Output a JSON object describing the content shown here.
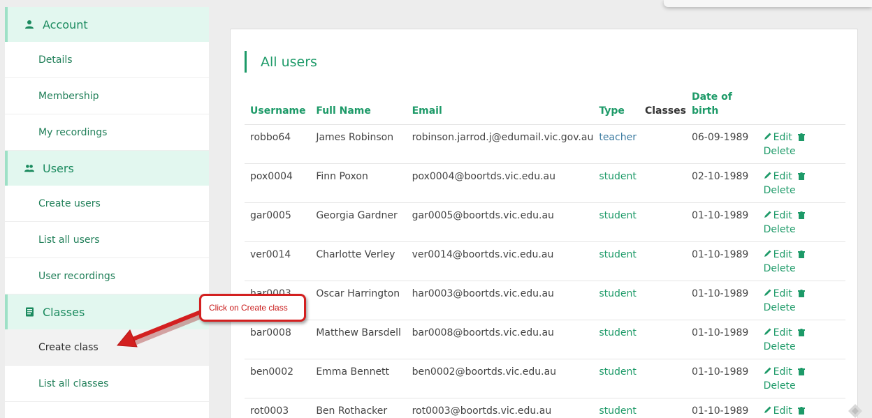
{
  "sidebar": {
    "sections": [
      {
        "title": "Account",
        "icon": "user-icon",
        "items": [
          "Details",
          "Membership",
          "My recordings"
        ]
      },
      {
        "title": "Users",
        "icon": "users-icon",
        "items": [
          "Create users",
          "List all users",
          "User recordings"
        ]
      },
      {
        "title": "Classes",
        "icon": "book-icon",
        "items": [
          "Create class",
          "List all classes"
        ]
      }
    ],
    "active_item": "Create class"
  },
  "main": {
    "title": "All users",
    "columns": [
      "Username",
      "Full Name",
      "Email",
      "Type",
      "Classes",
      "Date of birth"
    ],
    "edit_label": "Edit",
    "delete_label": "Delete",
    "rows": [
      {
        "username": "robbo64",
        "full_name": "James Robinson",
        "email": "robinson.jarrod.j@edumail.vic.gov.au",
        "type": "teacher",
        "classes": "",
        "dob": "06-09-1989"
      },
      {
        "username": "pox0004",
        "full_name": "Finn Poxon",
        "email": "pox0004@boortds.vic.edu.au",
        "type": "student",
        "classes": "",
        "dob": "02-10-1989"
      },
      {
        "username": "gar0005",
        "full_name": "Georgia Gardner",
        "email": "gar0005@boortds.vic.edu.au",
        "type": "student",
        "classes": "",
        "dob": "01-10-1989"
      },
      {
        "username": "ver0014",
        "full_name": "Charlotte Verley",
        "email": "ver0014@boortds.vic.edu.au",
        "type": "student",
        "classes": "",
        "dob": "01-10-1989"
      },
      {
        "username": "har0003",
        "full_name": "Oscar Harrington",
        "email": "har0003@boortds.vic.edu.au",
        "type": "student",
        "classes": "",
        "dob": "01-10-1989"
      },
      {
        "username": "bar0008",
        "full_name": "Matthew Barsdell",
        "email": "bar0008@boortds.vic.edu.au",
        "type": "student",
        "classes": "",
        "dob": "01-10-1989"
      },
      {
        "username": "ben0002",
        "full_name": "Emma Bennett",
        "email": "ben0002@boortds.vic.edu.au",
        "type": "student",
        "classes": "",
        "dob": "01-10-1989"
      },
      {
        "username": "rot0003",
        "full_name": "Ben Rothacker",
        "email": "rot0003@boortds.vic.edu.au",
        "type": "student",
        "classes": "",
        "dob": "01-10-1989"
      }
    ]
  },
  "callout": {
    "text": "Click on Create class"
  },
  "colors": {
    "accent": "#1d9a68",
    "section_bg": "#e2f7ef",
    "callout_red": "#d32020",
    "teacher": "#3b7aa0"
  }
}
